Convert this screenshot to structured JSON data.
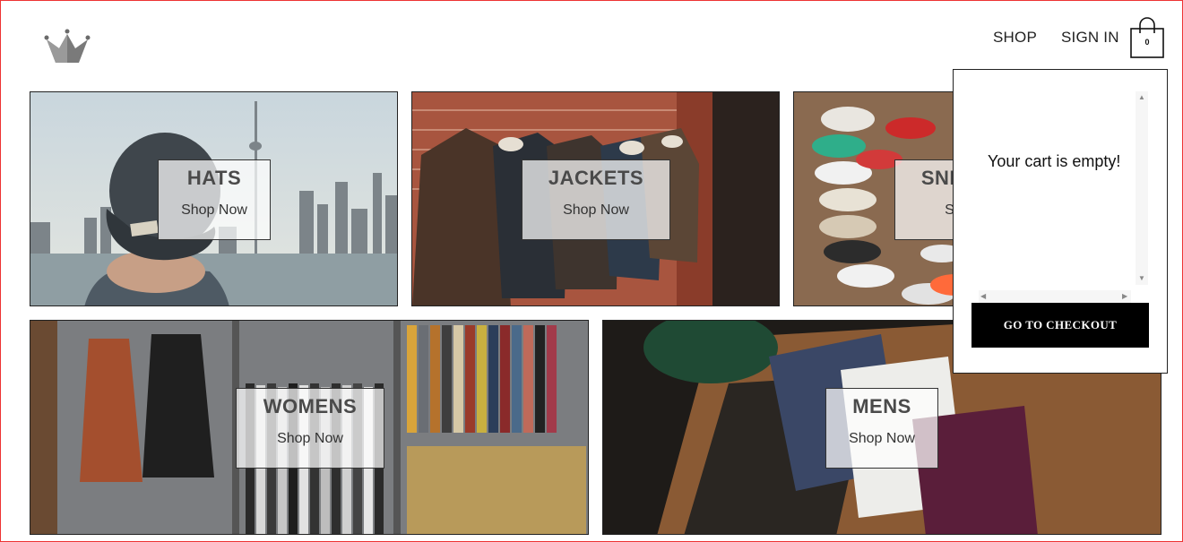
{
  "header": {
    "logo_icon": "crown-icon",
    "nav": {
      "shop": "SHOP",
      "sign_in": "SIGN IN"
    },
    "cart_icon": "shopping-bag-icon",
    "cart_count": "0"
  },
  "categories": [
    {
      "title": "HATS",
      "cta": "Shop Now"
    },
    {
      "title": "JACKETS",
      "cta": "Shop Now"
    },
    {
      "title": "SNEAKERS",
      "cta": "Shop Now"
    },
    {
      "title": "WOMENS",
      "cta": "Shop Now"
    },
    {
      "title": "MENS",
      "cta": "Shop Now"
    }
  ],
  "cart_dropdown": {
    "empty_message": "Your cart is empty!",
    "checkout_label": "GO TO CHECKOUT"
  },
  "colors": {
    "accent": "#000000",
    "frame": "#e33333"
  }
}
